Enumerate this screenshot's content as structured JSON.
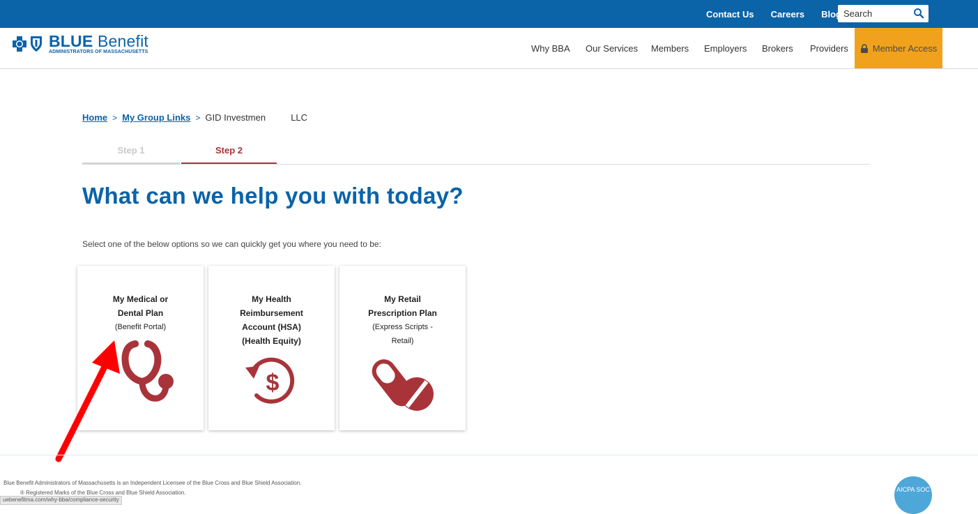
{
  "topbar": {
    "links": [
      "Contact Us",
      "Careers",
      "Blog"
    ],
    "search_placeholder": "Search"
  },
  "logo": {
    "main_bold": "BLUE",
    "main_rest": " Benefit",
    "sub": "ADMINISTRATORS OF MASSACHUSETTS"
  },
  "nav": {
    "items": [
      "Why BBA",
      "Our Services",
      "Members",
      "Employers",
      "Brokers",
      "Providers"
    ],
    "member_access": "Member Access"
  },
  "breadcrumb": {
    "home": "Home",
    "group_links": "My Group Links",
    "current": "GID Investmen          LLC"
  },
  "steps": {
    "step1": "Step 1",
    "step2": "Step 2"
  },
  "headline": "What can we help you with today?",
  "intro": "Select one of the below options so we can quickly get you where you need to be:",
  "cards": [
    {
      "title_lines": [
        "My Medical or",
        "Dental Plan"
      ],
      "sub_lines": [
        "(Benefit Portal)"
      ],
      "icon": "stethoscope-icon"
    },
    {
      "title_lines": [
        "My Health",
        "Reimbursement",
        "Account (HSA)",
        "(Health Equity)"
      ],
      "sub_lines": [],
      "icon": "dollar-refund-icon"
    },
    {
      "title_lines": [
        "My Retail",
        "Prescription Plan"
      ],
      "sub_lines": [
        "(Express Scripts -",
        "Retail)"
      ],
      "icon": "pills-icon"
    }
  ],
  "footer": {
    "line1": "Blue Benefit Administrators of Massachusetts is an Independent Licensee of the Blue Cross and Blue Shield Association.",
    "line2": "® Registered Marks of the Blue Cross and Blue Shield Association.",
    "status_url": "uebenefitma.com/why-bba/compliance-security",
    "badge": "AICPA SOC"
  },
  "colors": {
    "brand_blue": "#0b63a8",
    "accent_orange": "#f1a21c",
    "icon_red": "#a8343a",
    "annotation_arrow": "#ff0000"
  }
}
